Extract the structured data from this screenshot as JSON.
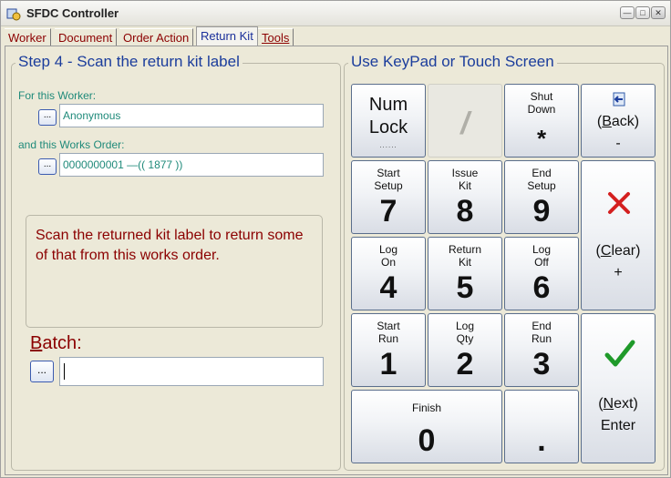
{
  "window": {
    "title": "SFDC Controller"
  },
  "tabs": [
    "Worker",
    "Document",
    "Order Action",
    "Return Kit",
    "Tools"
  ],
  "tab_colors": {
    "inactive": "#8b0000",
    "active": "#1a2f9a"
  },
  "left": {
    "title": "Step 4 - Scan the return kit label",
    "worker_label": "For this Worker:",
    "worker_button": "...",
    "worker_value": "Anonymous",
    "order_label": "and this Works Order:",
    "order_button": "...",
    "order_value": "0000000001    —(( 1877 ))",
    "message": "Scan the returned kit label to return some of that from this works order.",
    "batch_label_first": "B",
    "batch_label_rest": "atch:",
    "batch_button": "...",
    "batch_value": ""
  },
  "right": {
    "title": "Use KeyPad or Touch Screen",
    "keys": {
      "numlock": {
        "line1": "Num",
        "line2": "Lock",
        "dots": "......"
      },
      "slash": {
        "label": "/"
      },
      "shutdown": {
        "sub": "Shut\nDown",
        "digit": "*"
      },
      "back": {
        "pre": "(",
        "u": "B",
        "post": "ack)",
        "symbol": "-"
      },
      "k7": {
        "sub": "Start\nSetup",
        "digit": "7"
      },
      "k8": {
        "sub": "Issue\nKit",
        "digit": "8"
      },
      "k9": {
        "sub": "End\nSetup",
        "digit": "9"
      },
      "clear": {
        "pre": "(",
        "u": "C",
        "post": "lear)",
        "symbol": "+"
      },
      "k4": {
        "sub": "Log\nOn",
        "digit": "4"
      },
      "k5": {
        "sub": "Return\nKit",
        "digit": "5"
      },
      "k6": {
        "sub": "Log\nOff",
        "digit": "6"
      },
      "k1": {
        "sub": "Start\nRun",
        "digit": "1"
      },
      "k2": {
        "sub": "Log\nQty",
        "digit": "2"
      },
      "k3": {
        "sub": "End\nRun",
        "digit": "3"
      },
      "next": {
        "pre": "(",
        "u": "N",
        "post": "ext)",
        "symbol": "Enter"
      },
      "k0": {
        "sub": "Finish",
        "digit": "0"
      },
      "dot": {
        "digit": "."
      }
    }
  },
  "colors": {
    "accent_title": "#1b3d9c",
    "field_text": "#1f8a7a",
    "message": "#8b0000",
    "clear_x": "#d42020",
    "enter_check": "#1f9a2a"
  },
  "icons": {
    "back": "back-arrow-icon",
    "clear": "red-x-icon",
    "enter": "green-check-icon",
    "app": "app-icon"
  }
}
